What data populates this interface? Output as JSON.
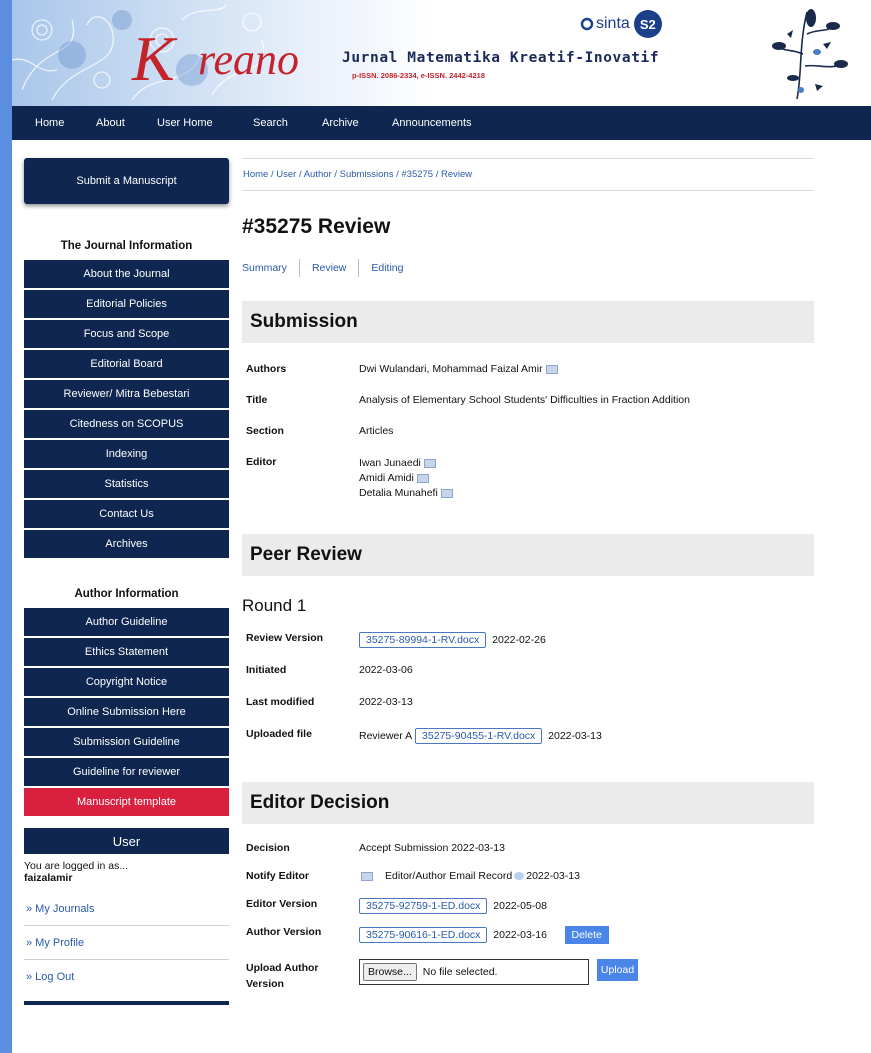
{
  "header": {
    "logo_initial": "K",
    "logo_rest": "reano",
    "journal_name": "Jurnal Matematika Kreatif-Inovatif",
    "issn": "p-ISSN. 2086-2334, e-ISSN. 2442-4218",
    "sinta_label": "sinta",
    "sinta_badge": "S2"
  },
  "nav": [
    "Home",
    "About",
    "User Home",
    "Search",
    "Archive",
    "Announcements"
  ],
  "sidebar": {
    "submit": "Submit a Manuscript",
    "journal_info_title": "The Journal Information",
    "journal_info": [
      "About the Journal",
      "Editorial Policies",
      "Focus and Scope",
      "Editorial Board",
      "Reviewer/ Mitra Bebestari",
      "Citedness on SCOPUS",
      "Indexing",
      "Statistics",
      "Contact Us",
      "Archives"
    ],
    "author_info_title": "Author Information",
    "author_info": [
      "Author Guideline",
      "Ethics Statement",
      "Copyright Notice",
      "Online Submission Here",
      "Submission Guideline",
      "Guideline for reviewer"
    ],
    "template": "Manuscript template",
    "user_title": "User",
    "logged_in": "You are logged in as...",
    "username": "faizalamir",
    "user_links": [
      "» My Journals",
      "» My Profile",
      "» Log Out"
    ]
  },
  "breadcrumb": "Home / User / Author / Submissions / #35275 / Review",
  "page_title": "#35275 Review",
  "tabs": [
    "Summary",
    "Review",
    "Editing"
  ],
  "submission": {
    "heading": "Submission",
    "labels": {
      "authors": "Authors",
      "title": "Title",
      "section": "Section",
      "editor": "Editor"
    },
    "authors": "Dwi Wulandari, Mohammad Faizal Amir",
    "title": "Analysis of Elementary School Students' Difficulties in Fraction Addition",
    "section": "Articles",
    "editors": [
      "Iwan Junaedi",
      "Amidi Amidi",
      "Detalia Munahefi"
    ]
  },
  "peer_review": {
    "heading": "Peer Review",
    "round": "Round 1",
    "labels": {
      "review_version": "Review Version",
      "initiated": "Initiated",
      "last_modified": "Last modified",
      "uploaded_file": "Uploaded file"
    },
    "review_version_file": "35275-89994-1-RV.docx",
    "review_version_date": "2022-02-26",
    "initiated": "2022-03-06",
    "last_modified": "2022-03-13",
    "uploaded_by": "Reviewer A",
    "uploaded_file": "35275-90455-1-RV.docx",
    "uploaded_date": "2022-03-13"
  },
  "editor_decision": {
    "heading": "Editor Decision",
    "labels": {
      "decision": "Decision",
      "notify": "Notify Editor",
      "editor_version": "Editor Version",
      "author_version": "Author Version",
      "upload": "Upload Author Version"
    },
    "decision": "Accept Submission 2022-03-13",
    "notify_record": "Editor/Author Email Record",
    "notify_date": "2022-03-13",
    "editor_version_file": "35275-92759-1-ED.docx",
    "editor_version_date": "2022-05-08",
    "author_version_file": "35275-90616-1-ED.docx",
    "author_version_date": "2022-03-16",
    "delete_label": "Delete",
    "browse_label": "Browse...",
    "no_file": "No file selected.",
    "upload_label": "Upload"
  }
}
